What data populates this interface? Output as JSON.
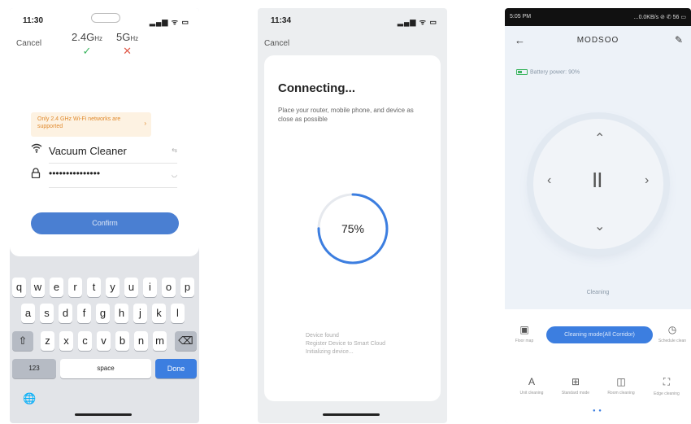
{
  "phone1": {
    "time": "11:30",
    "status_icons": "▂▄▆ ᯤ ▭",
    "cancel": "Cancel",
    "band_24": "2.4G",
    "band_24_unit": "Hz",
    "band_24_mark": "✓",
    "band_5": "5G",
    "band_5_unit": "Hz",
    "band_5_mark": "✕",
    "warning": "Only 2.4 GHz Wi-Fi networks are supported",
    "warning_arrow": "›",
    "wifi_icon": "wifi-icon",
    "wifi_name": "Vacuum Cleaner",
    "wifi_right": "⇆",
    "lock_icon": "lock-icon",
    "password": "•••••••••••••••",
    "password_right": "◡",
    "confirm": "Confirm",
    "keyboard": {
      "row1": [
        "q",
        "w",
        "e",
        "r",
        "t",
        "y",
        "u",
        "i",
        "o",
        "p"
      ],
      "row2": [
        "a",
        "s",
        "d",
        "f",
        "g",
        "h",
        "j",
        "k",
        "l"
      ],
      "row3": [
        "z",
        "x",
        "c",
        "v",
        "b",
        "n",
        "m"
      ],
      "shift": "⇧",
      "backspace": "⌫",
      "numbers": "123",
      "space": "space",
      "done": "Done",
      "globe": "🌐"
    }
  },
  "phone2": {
    "time": "11:34",
    "status_icons": "▂▄▆ ᯤ ▭",
    "cancel": "Cancel",
    "title": "Connecting...",
    "description": "Place your router, mobile phone, and device as close as possible",
    "progress_label": "75%",
    "progress": 0.75,
    "footer_line1": "Device found",
    "footer_line2": "Register Device to Smart Cloud",
    "footer_line3": "Initializing device..."
  },
  "phone3": {
    "time": "5:05 PM",
    "status_icons": "...0.0KB/s ⊘ ✆ 56 ▭",
    "back": "←",
    "device_name": "MODSOO",
    "edit": "✎",
    "battery": "Battery power: 90%",
    "arrow_up": "⌃",
    "arrow_down": "⌄",
    "arrow_left": "‹",
    "arrow_right": "›",
    "pause": "II",
    "status": "Cleaning",
    "pill": "Cleaning mode(All Corridor)",
    "map_label": "Floor map",
    "schedule_label": "Schedule clean",
    "btn1_label": "Unit cleaning",
    "btn2_label": "Standard mode",
    "btn3_label": "Room cleaning",
    "btn4_label": "Edge cleaning",
    "icon_map": "▣",
    "icon_clock": "◷",
    "icon_a": "A",
    "icon_mode": "⊞",
    "icon_room": "◫",
    "icon_edge": "⛶",
    "dots": "● ●"
  },
  "colors": {
    "accent": "#3c7ee0",
    "confirm_button": "#4a7fd2",
    "success": "#3cb560",
    "error": "#e05a4a",
    "warning_text": "#e08a2e",
    "warning_bg": "#fdf2e2"
  }
}
